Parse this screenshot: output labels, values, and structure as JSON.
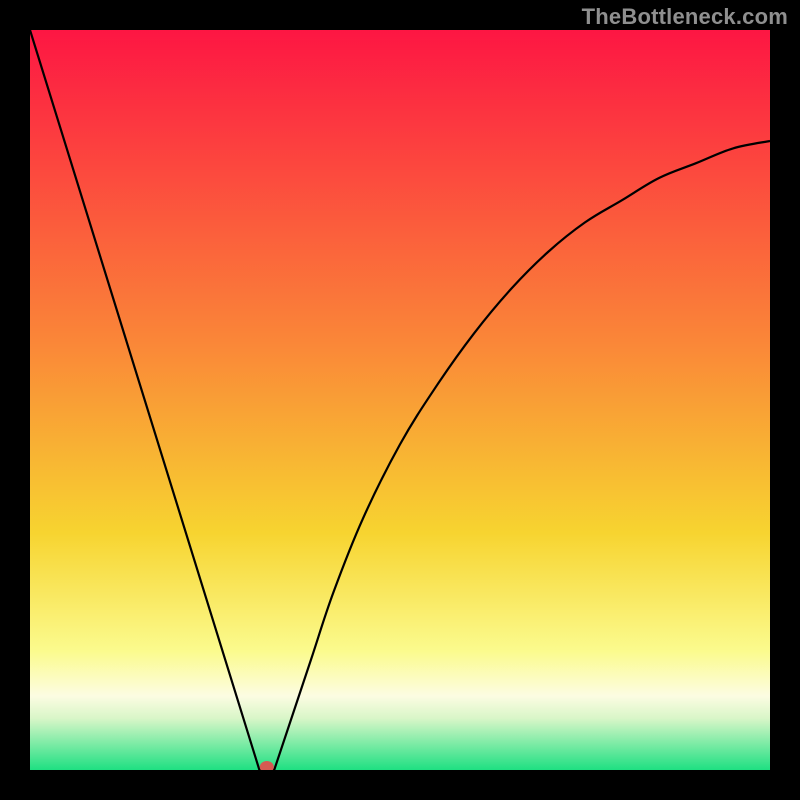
{
  "watermark": "TheBottleneck.com",
  "colors": {
    "background": "#000000",
    "curve": "#000000",
    "marker": "#d65a52",
    "gradient_top": "#fd1643",
    "gradient_mid1": "#fa8638",
    "gradient_mid2": "#f7d430",
    "gradient_mid3": "#fbfb8e",
    "gradient_mid4": "#fcfce2",
    "gradient_bottom": "#1ee082"
  },
  "chart_data": {
    "type": "line",
    "title": "",
    "xlabel": "",
    "ylabel": "",
    "xlim": [
      0,
      100
    ],
    "ylim": [
      0,
      100
    ],
    "left_segment": {
      "x": [
        0,
        31
      ],
      "y": [
        100,
        0
      ]
    },
    "right_curve": {
      "x": [
        33,
        35,
        38,
        41,
        45,
        50,
        55,
        60,
        65,
        70,
        75,
        80,
        85,
        90,
        95,
        100
      ],
      "y": [
        0,
        6,
        15,
        24,
        34,
        44,
        52,
        59,
        65,
        70,
        74,
        77,
        80,
        82,
        84,
        85
      ]
    },
    "flat_segment": {
      "x": [
        31,
        33
      ],
      "y": [
        0,
        0
      ]
    },
    "marker": {
      "x": 32,
      "y": 0
    },
    "gradient_stops_pct": [
      0,
      42,
      68,
      84,
      90,
      93,
      100
    ],
    "annotations": []
  }
}
